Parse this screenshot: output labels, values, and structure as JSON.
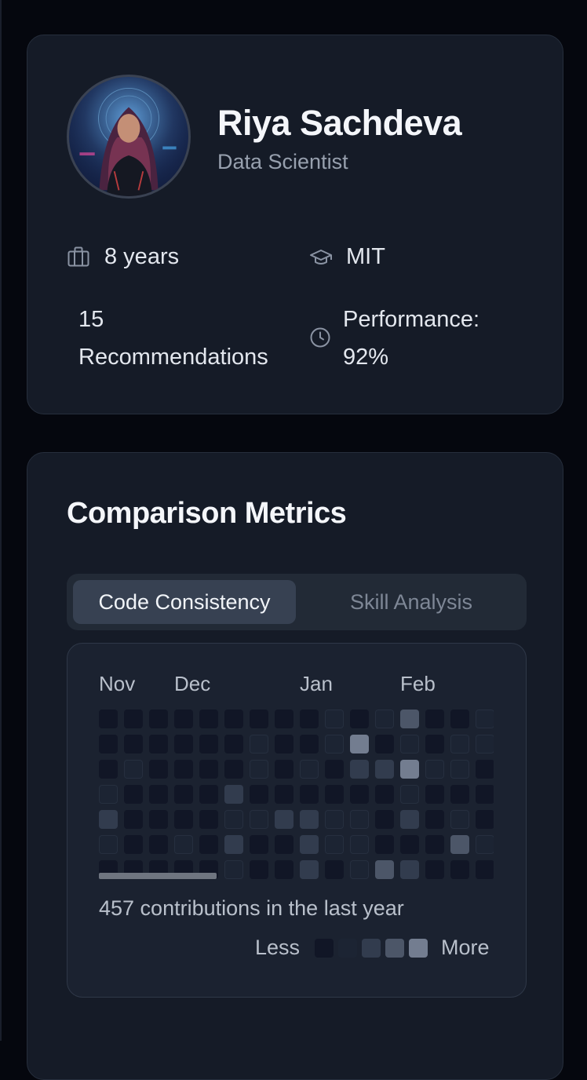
{
  "profile": {
    "name": "Riya Sachdeva",
    "role": "Data Scientist",
    "stats": {
      "experience": "8 years",
      "education": "MIT",
      "recommendations_line1": "15",
      "recommendations_line2": "Recommendations",
      "performance_line1": "Performance:",
      "performance_line2": "92%"
    },
    "icons": {
      "experience": "briefcase-icon",
      "education": "graduation-cap-icon",
      "performance": "clock-icon"
    }
  },
  "metrics": {
    "title": "Comparison Metrics",
    "tabs": [
      {
        "label": "Code Consistency",
        "active": true
      },
      {
        "label": "Skill Analysis",
        "active": false
      }
    ],
    "heatmap": {
      "months": [
        "Nov",
        "Dec",
        "Jan",
        "Feb"
      ],
      "summary": "457 contributions in the last year",
      "legend_less": "Less",
      "legend_more": "More",
      "levels": [
        [
          0,
          0,
          0,
          0,
          0,
          0,
          0,
          0,
          0,
          1,
          0,
          1,
          3,
          0,
          0,
          1
        ],
        [
          0,
          0,
          0,
          0,
          0,
          0,
          1,
          0,
          0,
          1,
          4,
          0,
          1,
          0,
          1,
          1
        ],
        [
          0,
          1,
          0,
          0,
          0,
          0,
          1,
          0,
          1,
          0,
          2,
          2,
          4,
          1,
          1,
          0
        ],
        [
          1,
          0,
          0,
          0,
          0,
          2,
          0,
          0,
          0,
          0,
          0,
          0,
          1,
          0,
          0,
          0
        ],
        [
          2,
          0,
          0,
          0,
          0,
          1,
          1,
          2,
          2,
          1,
          1,
          0,
          2,
          0,
          1,
          0
        ],
        [
          1,
          0,
          0,
          1,
          0,
          2,
          0,
          0,
          2,
          1,
          1,
          0,
          0,
          0,
          3,
          1
        ],
        [
          0,
          0,
          0,
          0,
          0,
          1,
          0,
          0,
          2,
          0,
          1,
          3,
          2,
          0,
          0,
          0
        ]
      ]
    }
  },
  "colors": {
    "background": "#05070e",
    "card": "#151b27",
    "level0": "#111626",
    "level1": "#1c2433",
    "level2": "#323c4e",
    "level3": "#4c5668",
    "level4": "#737d90"
  }
}
